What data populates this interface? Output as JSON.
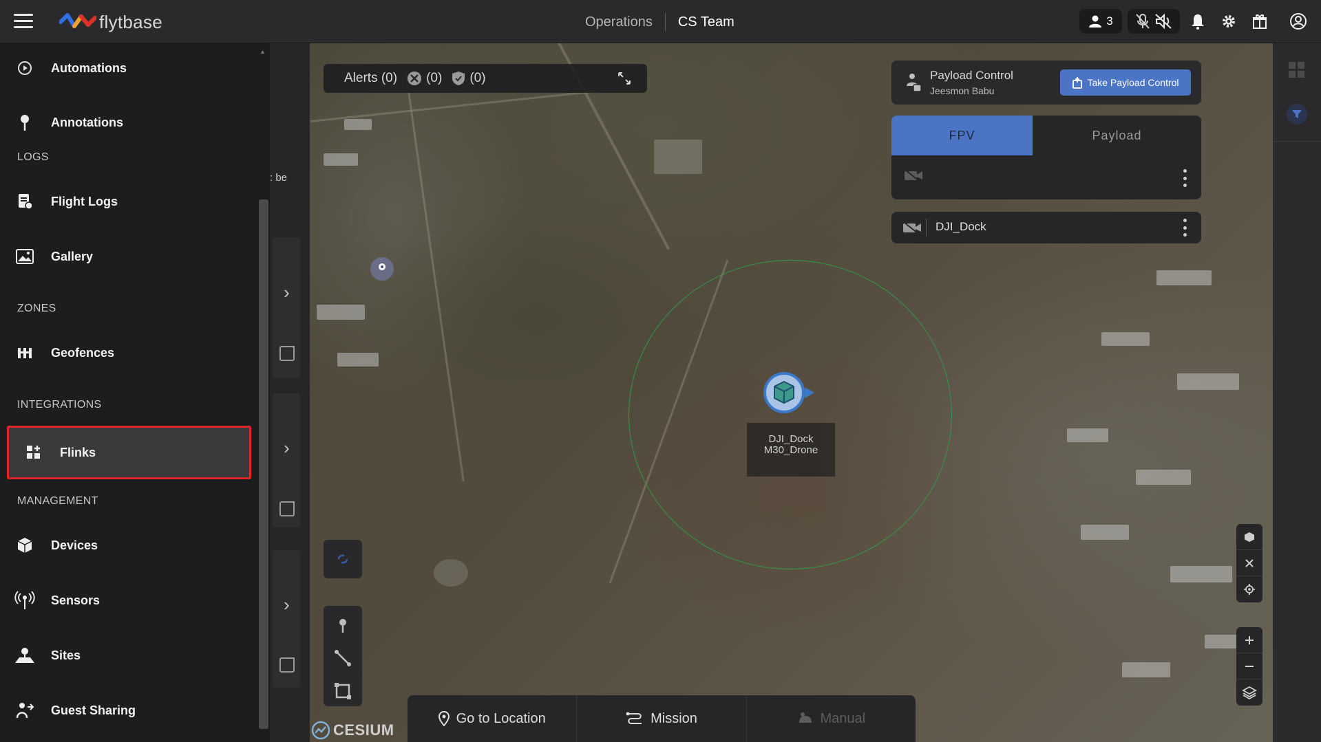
{
  "topbar": {
    "brand": "flytbase",
    "nav_operations": "Operations",
    "nav_team": "CS Team",
    "users_count": "3",
    "icons": [
      "menu-icon",
      "users-icon",
      "mic-off-icon",
      "speaker-off-icon",
      "bell-icon",
      "gear-icon",
      "gift-icon",
      "account-icon"
    ]
  },
  "sidebar": {
    "items_top": [
      {
        "label": "Automations",
        "icon": "automation-icon"
      },
      {
        "label": "Annotations",
        "icon": "pin-icon"
      }
    ],
    "sections": [
      {
        "title": "LOGS",
        "items": [
          {
            "label": "Flight Logs",
            "icon": "flight-log-icon"
          },
          {
            "label": "Gallery",
            "icon": "gallery-icon"
          }
        ]
      },
      {
        "title": "ZONES",
        "items": [
          {
            "label": "Geofences",
            "icon": "geofence-icon"
          }
        ]
      },
      {
        "title": "INTEGRATIONS",
        "items": [
          {
            "label": "Flinks",
            "icon": "flinks-icon"
          }
        ]
      },
      {
        "title": "MANAGEMENT",
        "items": [
          {
            "label": "Devices",
            "icon": "cube-icon"
          },
          {
            "label": "Sensors",
            "icon": "sensor-icon"
          },
          {
            "label": "Sites",
            "icon": "site-icon"
          },
          {
            "label": "Guest Sharing",
            "icon": "share-icon"
          }
        ]
      }
    ],
    "active_item": "Flinks",
    "highlight_color": "#e0252a"
  },
  "collapsed_panel": {
    "partial_text": ": be"
  },
  "alerts": {
    "label": "Alerts (0)",
    "drone_count": "(0)",
    "shield_count": "(0)"
  },
  "payload_control": {
    "title": "Payload Control",
    "owner": "Jeesmon Babu",
    "take_button": "Take Payload Control"
  },
  "feed_tabs": {
    "fpv": "FPV",
    "payload": "Payload",
    "active": "FPV"
  },
  "dock": {
    "name": "DJI_Dock"
  },
  "map": {
    "drone_label_line1": "DJI_Dock",
    "drone_label_line2": "M30_Drone",
    "geofence_color": "#2f9a45",
    "attribution": "CESIUM"
  },
  "bottom_bar": {
    "go_to_location": "Go to Location",
    "mission": "Mission",
    "manual": "Manual"
  },
  "colors": {
    "accent": "#4c74c4",
    "background": "#1d1d1f",
    "active_item_bg": "#3a3a3c"
  }
}
